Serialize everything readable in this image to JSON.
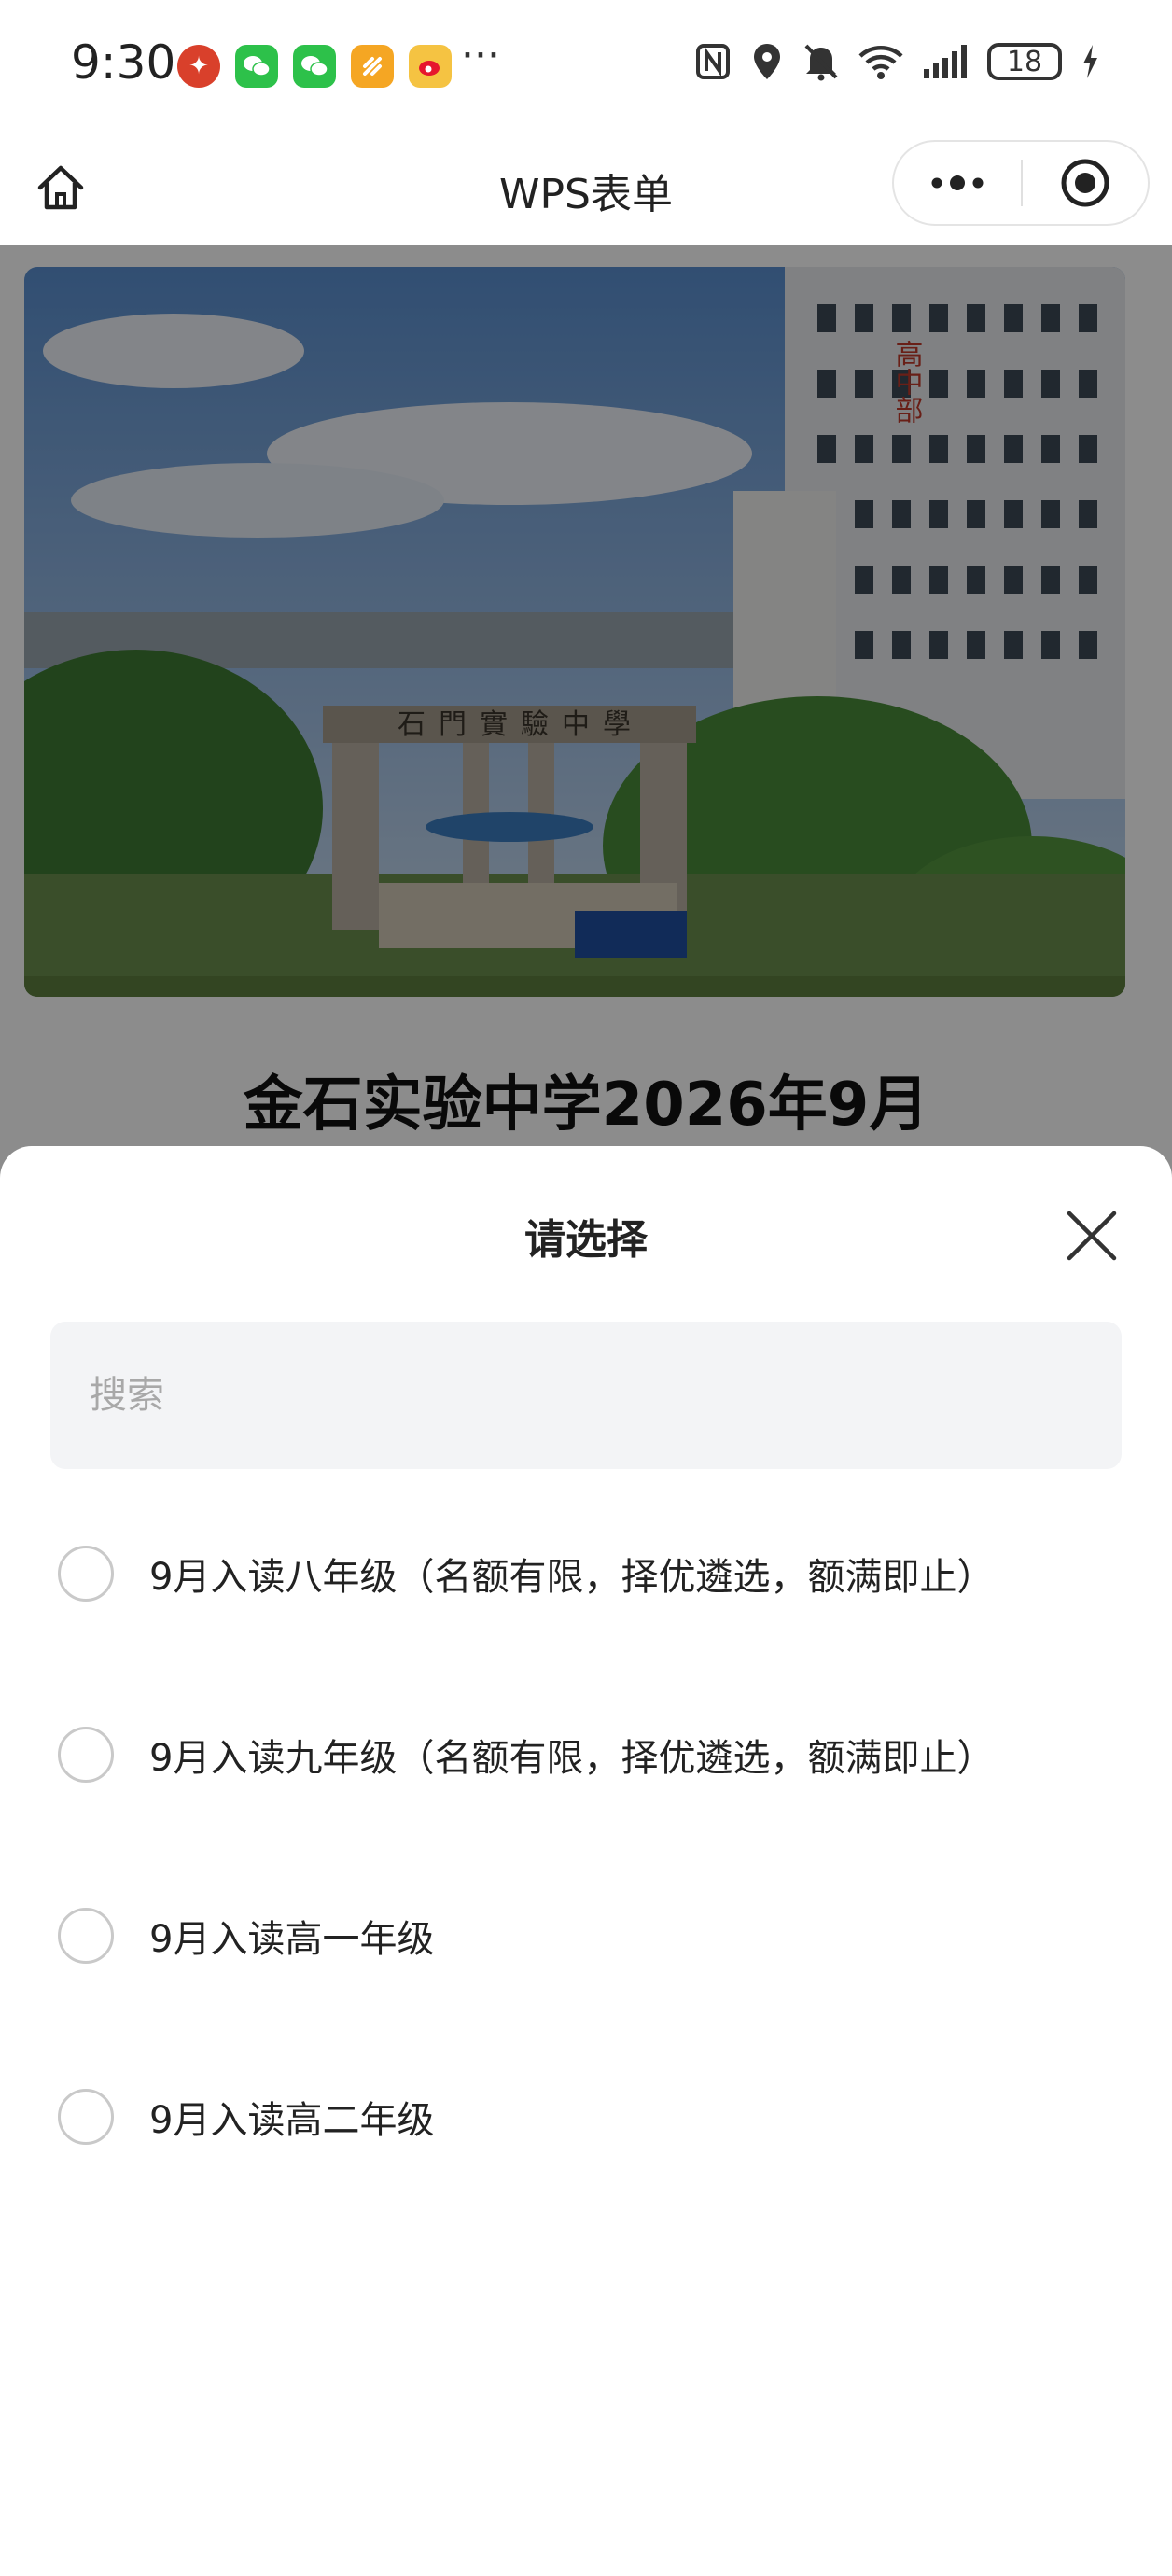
{
  "status_bar": {
    "time": "9:30",
    "more": "···",
    "battery": "18",
    "notification_icons": [
      "app-icon",
      "wechat-icon",
      "wechat-icon",
      "app-icon",
      "weibo-icon"
    ],
    "system_icons": [
      "nfc-icon",
      "location-icon",
      "mute-icon",
      "wifi-icon",
      "signal-icon",
      "battery-icon",
      "charging-icon"
    ]
  },
  "nav": {
    "title": "WPS表单",
    "home_icon": "home-icon",
    "more_icon": "more-icon",
    "target_icon": "target-icon"
  },
  "page": {
    "title": "金石实验中学2026年9月",
    "banner_sign": "石門實驗中學",
    "building_sign": "高中部"
  },
  "sheet": {
    "title": "请选择",
    "close_icon": "close-icon",
    "search_placeholder": "搜索",
    "options": [
      {
        "label": "9月入读八年级（名额有限，择优遴选，额满即止）",
        "selected": false
      },
      {
        "label": "9月入读九年级（名额有限，择优遴选，额满即止）",
        "selected": false
      },
      {
        "label": "9月入读高一年级",
        "selected": false
      },
      {
        "label": "9月入读高二年级",
        "selected": false
      }
    ]
  },
  "colors": {
    "overlay": "#000000",
    "radio_border": "#c9c9c9",
    "search_bg": "#f3f4f6"
  }
}
